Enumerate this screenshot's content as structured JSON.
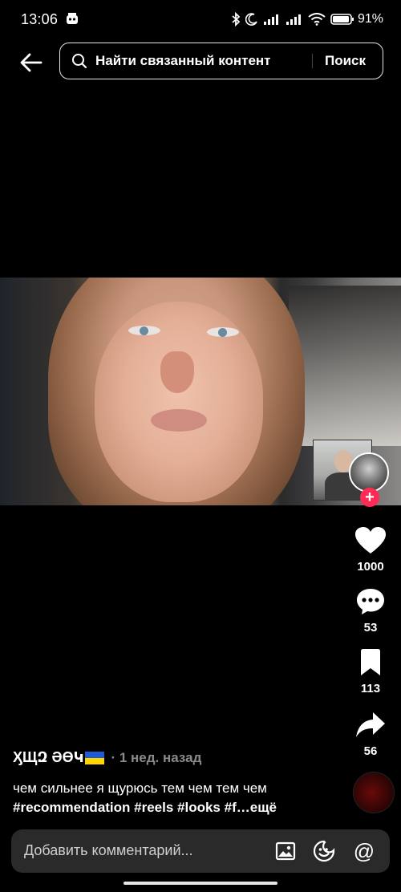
{
  "status_bar": {
    "time": "13:06",
    "battery": "91"
  },
  "search": {
    "query": "Найти связанный контент",
    "submit_label": "Поиск"
  },
  "post": {
    "author": "ӼЩԶ ƏӨԿ",
    "time_ago": "· 1 нед. назад",
    "caption_text": "чем сильнее я щурюсь тем чем тем чем",
    "caption_tags": "#recommendation #reels #looks #f…",
    "more_label": "ещё"
  },
  "actions": {
    "likes": "1000",
    "comments": "53",
    "saves": "113",
    "shares": "56"
  },
  "comment_bar": {
    "placeholder": "Добавить комментарий..."
  },
  "colors": {
    "background": "#000000",
    "accent": "#fe2c55",
    "flag_blue": "#1f5bd7",
    "flag_yellow": "#ffd500"
  },
  "icons": [
    "bell-off-icon",
    "bluetooth-icon",
    "moon-icon",
    "signal-icon",
    "wifi-icon",
    "battery-icon",
    "back-arrow-icon",
    "search-icon",
    "heart-icon",
    "comment-icon",
    "bookmark-icon",
    "share-icon",
    "image-icon",
    "emoji-icon",
    "mention-icon"
  ]
}
